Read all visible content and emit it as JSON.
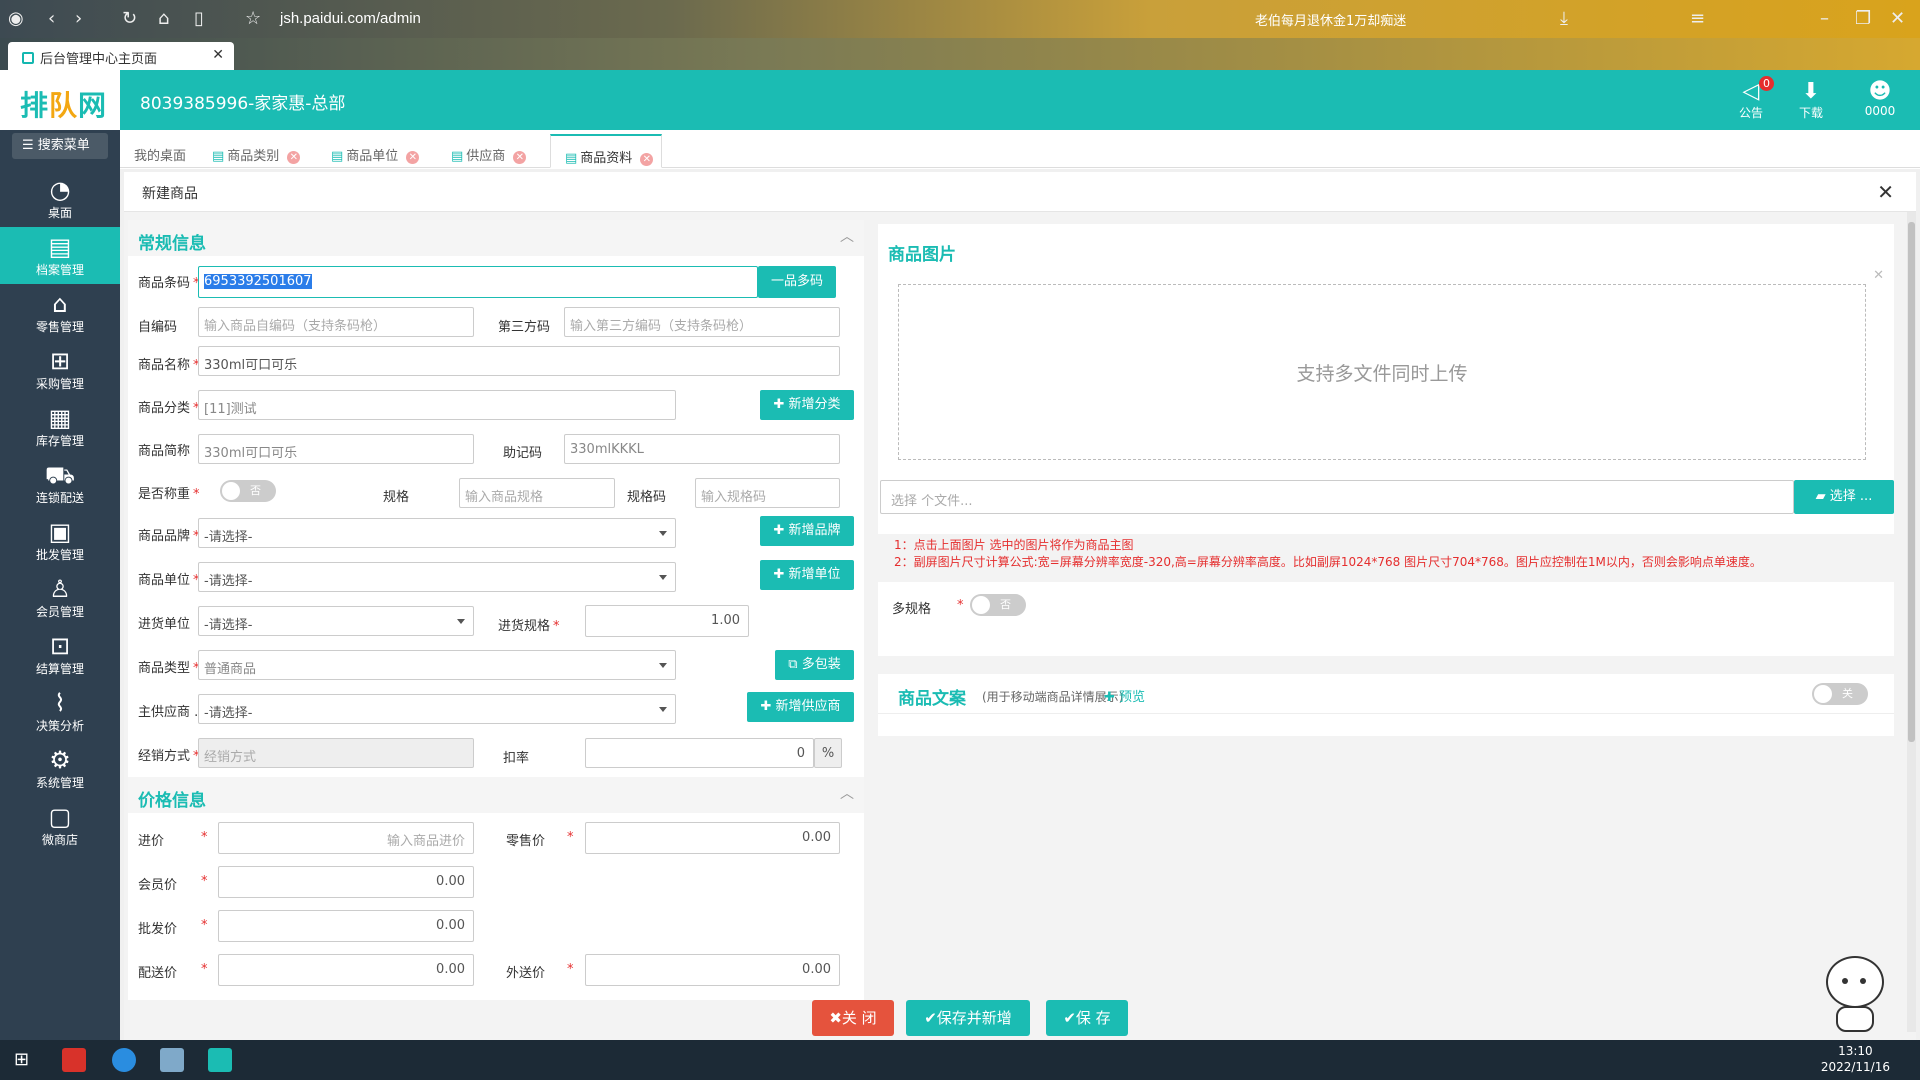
{
  "browser": {
    "url": "jsh.paidui.com/admin",
    "tab_title": "后台管理中心主页面",
    "news": "老伯每月退休金1万却痴迷"
  },
  "header": {
    "logo": "排队网",
    "store": "8039385996-家家惠-总部",
    "notice_label": "公告",
    "notice_badge": "0",
    "download_label": "下载",
    "user_label": "0000"
  },
  "sidebar": {
    "search": "搜索菜单",
    "items": [
      {
        "label": "桌面",
        "icon": "dashboard-icon"
      },
      {
        "label": "档案管理",
        "icon": "archive-icon"
      },
      {
        "label": "零售管理",
        "icon": "store-icon"
      },
      {
        "label": "采购管理",
        "icon": "cart-icon"
      },
      {
        "label": "库存管理",
        "icon": "inventory-icon"
      },
      {
        "label": "连锁配送",
        "icon": "truck-icon"
      },
      {
        "label": "批发管理",
        "icon": "wholesale-icon"
      },
      {
        "label": "会员管理",
        "icon": "member-icon"
      },
      {
        "label": "结算管理",
        "icon": "settle-icon"
      },
      {
        "label": "决策分析",
        "icon": "chart-icon"
      },
      {
        "label": "系统管理",
        "icon": "gear-icon"
      },
      {
        "label": "微商店",
        "icon": "bag-icon"
      }
    ]
  },
  "tabs": [
    "我的桌面",
    "商品类别",
    "商品单位",
    "供应商",
    "商品资料"
  ],
  "modal": {
    "title": "新建商品"
  },
  "general": {
    "section": "常规信息",
    "barcode_label": "商品条码",
    "barcode_value": "6953392501607",
    "multi_code_btn": "一品多码",
    "selfcode_label": "自编码",
    "selfcode_ph": "输入商品自编码（支持条码枪）",
    "thirdcode_label": "第三方码",
    "thirdcode_ph": "输入第三方编码（支持条码枪）",
    "name_label": "商品名称",
    "name_value": "330ml可口可乐",
    "category_label": "商品分类",
    "category_value": "[11]测试",
    "add_category": "新增分类",
    "short_label": "商品简称",
    "short_value": "330ml可口可乐",
    "mnemonic_label": "助记码",
    "mnemonic_value": "330mlKKKL",
    "weigh_label": "是否称重",
    "weigh_toggle": "否",
    "spec_label": "规格",
    "spec_ph": "输入商品规格",
    "speccode_label": "规格码",
    "speccode_ph": "输入规格码",
    "brand_label": "商品品牌",
    "brand_value": "-请选择-",
    "add_brand": "新增品牌",
    "unit_label": "商品单位",
    "unit_value": "-请选择-",
    "add_unit": "新增单位",
    "purunit_label": "进货单位",
    "purunit_value": "-请选择-",
    "purspec_label": "进货规格",
    "purspec_value": "1.00",
    "type_label": "商品类型",
    "type_value": "普通商品",
    "multi_pack": "多包装",
    "supplier_label": "主供应商 ...",
    "supplier_value": "-请选择-",
    "add_supplier": "新增供应商",
    "sale_label": "经销方式",
    "sale_ph": "经销方式",
    "discount_label": "扣率",
    "discount_value": "0",
    "discount_unit": "%"
  },
  "price": {
    "section": "价格信息",
    "buy_label": "进价",
    "buy_ph": "输入商品进价",
    "retail_label": "零售价",
    "retail_value": "0.00",
    "member_label": "会员价",
    "member_value": "0.00",
    "wholesale_label": "批发价",
    "wholesale_value": "0.00",
    "dist_label": "配送价",
    "dist_value": "0.00",
    "out_label": "外送价",
    "out_value": "0.00"
  },
  "image": {
    "section": "商品图片",
    "upload_text": "支持多文件同时上传",
    "file_ph": "选择 个文件...",
    "choose_btn": "选择 ...",
    "note1": "1：点击上面图片 选中的图片将作为商品主图",
    "note2": "2：副屏图片尺寸计算公式:宽=屏幕分辨率宽度-320,高=屏幕分辨率高度。比如副屏1024*768 图片尺寸704*768。图片应控制在1M以内，否则会影响点单速度。"
  },
  "multispec": {
    "label": "多规格",
    "toggle": "否"
  },
  "copy": {
    "title": "商品文案",
    "hint": "(用于移动端商品详情展示)",
    "preview": "预览",
    "toggle": "关"
  },
  "footer": {
    "close": "关 闭",
    "save_new": "保存并新增",
    "save": "保 存"
  },
  "taskbar": {
    "time": "13:10",
    "date": "2022/11/16"
  },
  "colors": {
    "primary": "#1bbcb3",
    "sidebar": "#2f4050",
    "danger": "#e5533d"
  }
}
